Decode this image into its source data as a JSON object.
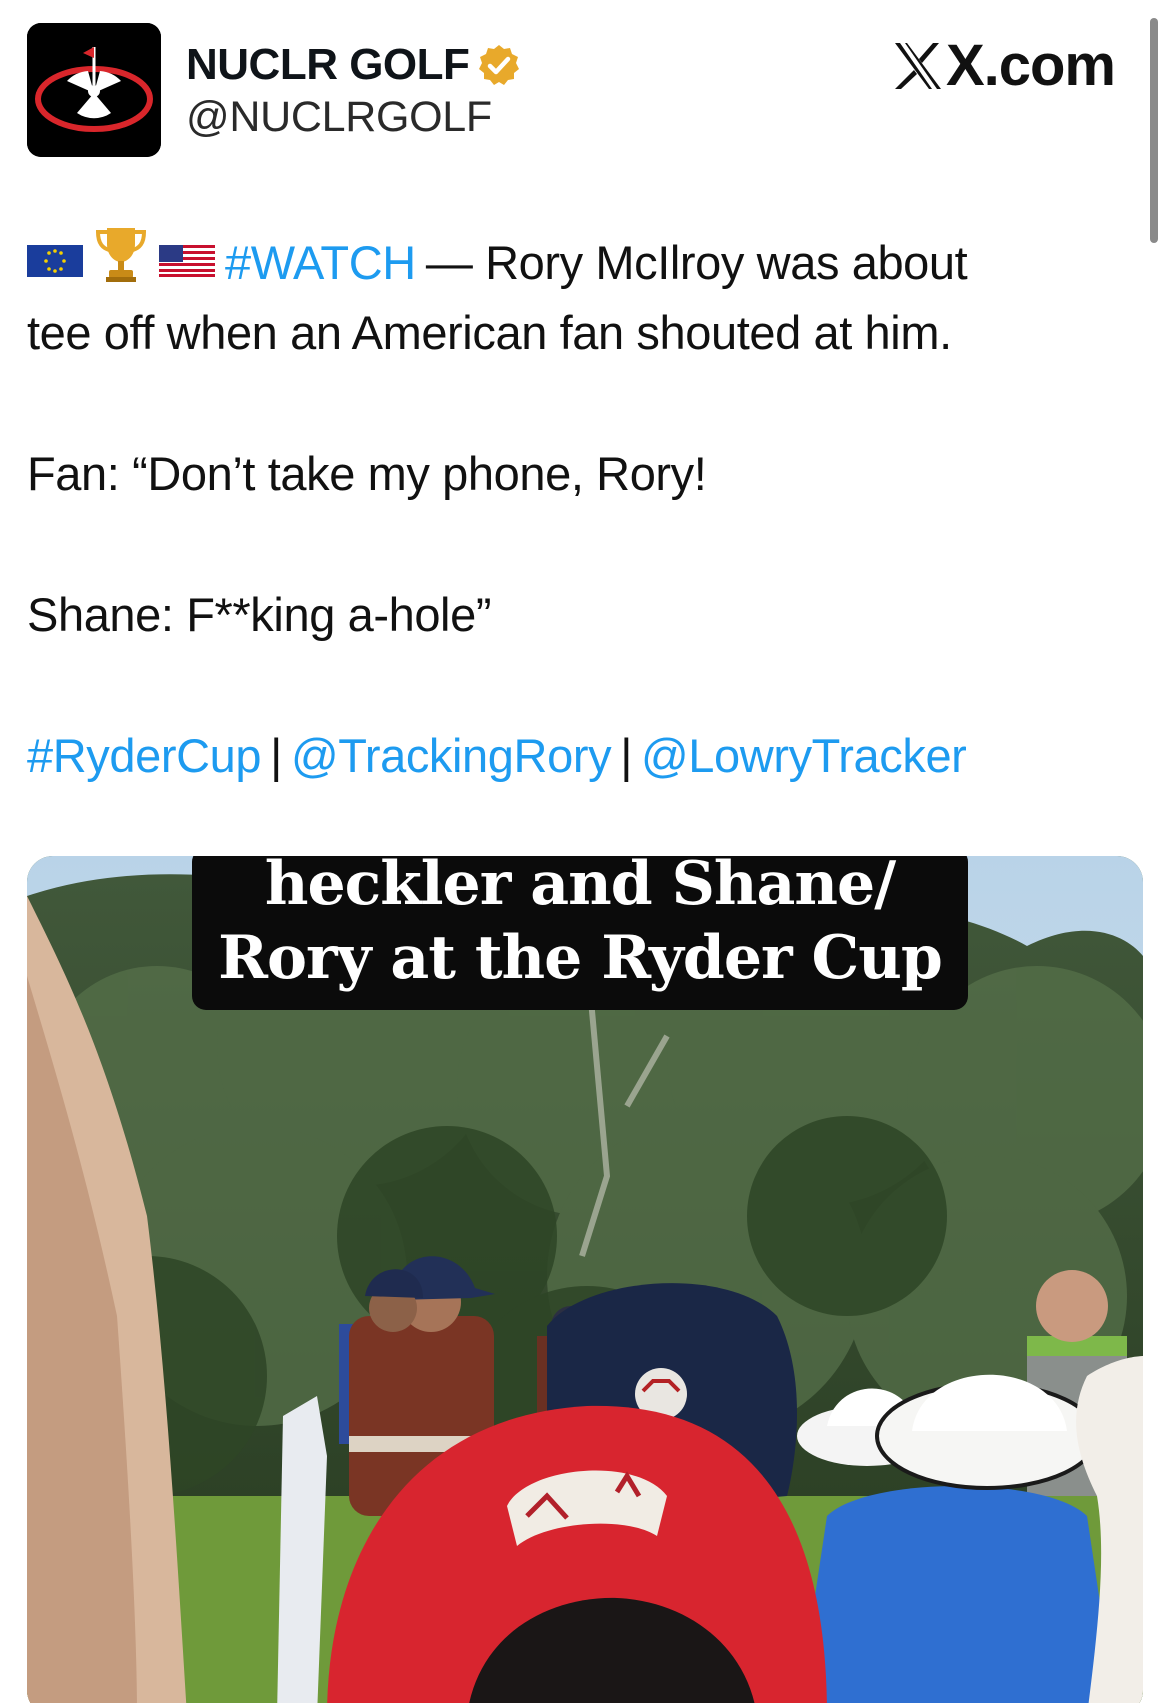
{
  "header": {
    "display_name": "NUCLR GOLF",
    "handle": "@NUCLRGOLF",
    "brand": "X.com",
    "icons": {
      "avatar": "nuclr-golf-logo-icon",
      "verified": "verified-badge-icon",
      "brand_logo": "x-logo-icon"
    }
  },
  "tweet": {
    "line1": {
      "emojis": [
        "eu-flag-icon",
        "trophy-icon",
        "us-flag-icon"
      ],
      "hashtag": "#WATCH",
      "text": "— Rory McIlroy was about"
    },
    "line2": "tee off when an American fan shouted at him.",
    "line3": "Fan: “Don’t take my phone, Rory!",
    "line4": "Shane: F**king a-hole”",
    "tags": [
      "#RyderCup",
      "@TrackingRory",
      "@LowryTracker"
    ],
    "tag_separator": "|"
  },
  "media": {
    "caption_line1": "heckler and Shane/",
    "caption_line2": "Rory at the Ryder Cup"
  },
  "colors": {
    "link": "#1d9bf0",
    "text": "#0f1419",
    "verified_badge": "#e8a92b",
    "caption_bg": "#0b0b0b"
  }
}
